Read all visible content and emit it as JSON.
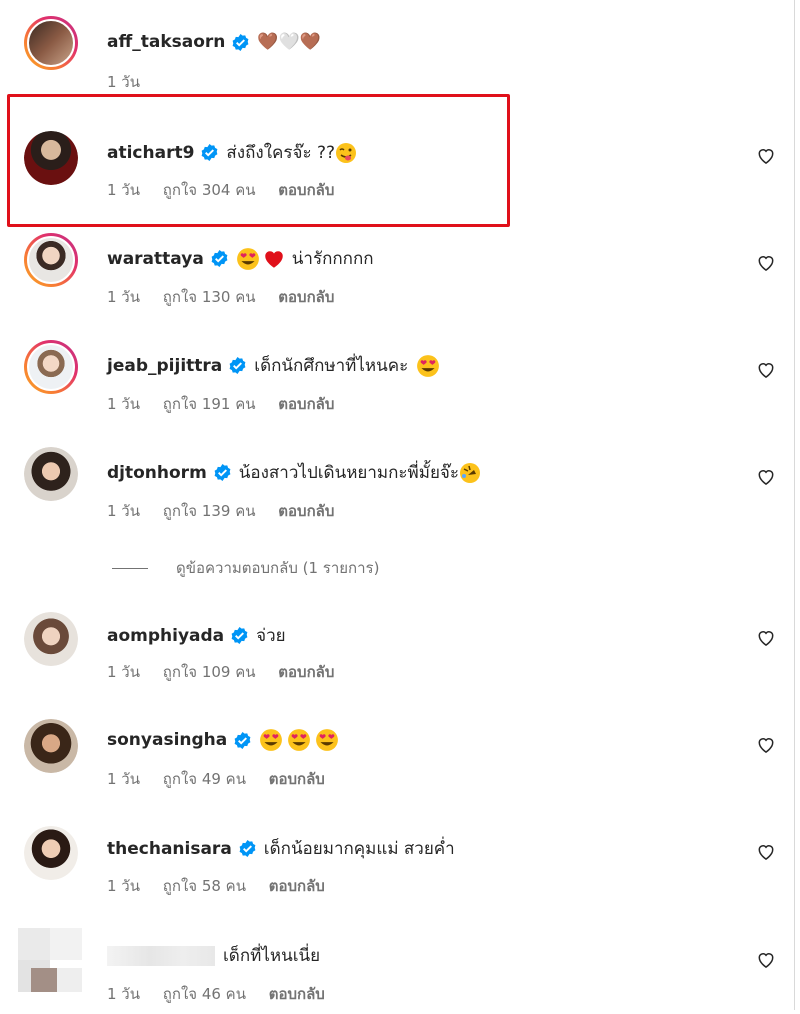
{
  "comments": [
    {
      "username": "aff_taksaorn",
      "verified": true,
      "text": "🤎🤍🤎",
      "time": "1 วัน",
      "likes": "",
      "reply": ""
    },
    {
      "username": "atichart9",
      "verified": true,
      "text": "ส่งถึงใครจ๊ะ ??",
      "time": "1 วัน",
      "likes": "ถูกใจ 304 คน",
      "reply": "ตอบกลับ"
    },
    {
      "username": "warattaya",
      "verified": true,
      "text": "น่ารักกกกก",
      "time": "1 วัน",
      "likes": "ถูกใจ 130 คน",
      "reply": "ตอบกลับ"
    },
    {
      "username": "jeab_pijittra",
      "verified": true,
      "text": "เด็กนักศึกษาที่ไหนคะ",
      "time": "1 วัน",
      "likes": "ถูกใจ 191 คน",
      "reply": "ตอบกลับ"
    },
    {
      "username": "djtonhorm",
      "verified": true,
      "text": "น้องสาวไปเดินหยามกะพี่มั้ยจ๊ะ",
      "time": "1 วัน",
      "likes": "ถูกใจ 139 คน",
      "reply": "ตอบกลับ"
    },
    {
      "username": "aomphiyada",
      "verified": true,
      "text": "จ่วย",
      "time": "1 วัน",
      "likes": "ถูกใจ 109 คน",
      "reply": "ตอบกลับ"
    },
    {
      "username": "sonyasingha",
      "verified": true,
      "text": "",
      "time": "1 วัน",
      "likes": "ถูกใจ 49 คน",
      "reply": "ตอบกลับ"
    },
    {
      "username": "thechanisara",
      "verified": true,
      "text": "เด็กน้อยมากคุมแม่ สวยค่ำ",
      "time": "1 วัน",
      "likes": "ถูกใจ 58 คน",
      "reply": "ตอบกลับ"
    },
    {
      "username": "",
      "verified": false,
      "text": "เด็กที่ไหนเนี่ย",
      "time": "1 วัน",
      "likes": "ถูกใจ 46 คน",
      "reply": "ตอบกลับ"
    }
  ],
  "view_replies_label": "ดูข้อความตอบกลับ (1 รายการ)",
  "colors": {
    "highlight": "#e0101a",
    "verified": "#0095f6",
    "meta": "#737373"
  }
}
